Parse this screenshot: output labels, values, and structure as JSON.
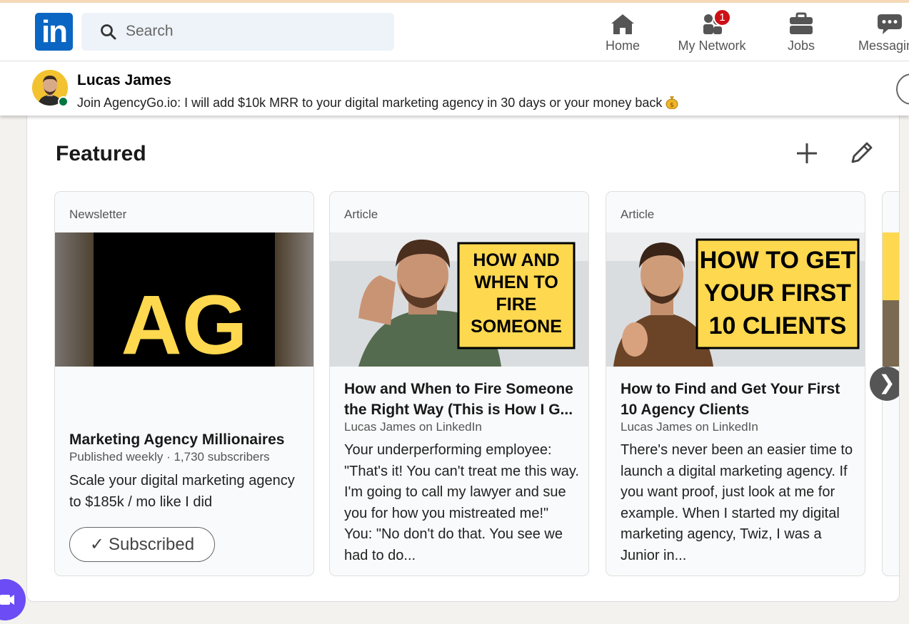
{
  "nav": {
    "logo_text": "in",
    "search_placeholder": "Search",
    "items": [
      {
        "label": "Home",
        "icon": "home-icon"
      },
      {
        "label": "My Network",
        "icon": "people-icon",
        "badge": "1"
      },
      {
        "label": "Jobs",
        "icon": "briefcase-icon"
      },
      {
        "label": "Messaging",
        "icon": "messaging-icon"
      }
    ]
  },
  "profile": {
    "name": "Lucas James",
    "headline": "Join AgencyGo.io: I will add $10k MRR to your digital marketing agency in 30 days or your money back"
  },
  "featured": {
    "title": "Featured",
    "items": [
      {
        "type": "Newsletter",
        "logo_text": "AG",
        "title": "Marketing Agency Millionaires",
        "subtitle": "Published weekly · 1,730 subscribers",
        "description": "Scale your digital marketing agency to $185k / mo like I did",
        "button_label": "Subscribed"
      },
      {
        "type": "Article",
        "thumb_text": [
          "HOW AND",
          "WHEN TO",
          "FIRE",
          "SOMEONE"
        ],
        "title": "How and When to Fire Someone the Right Way (This is How I G...",
        "author": "Lucas James on LinkedIn",
        "description": "Your underperforming employee: \"That's it! You can't treat me this way. I'm going to call my lawyer and sue you for how you mistreated me!\" You: \"No don't do that. You see we had to do..."
      },
      {
        "type": "Article",
        "thumb_text": [
          "HOW TO GET",
          "YOUR FIRST",
          "10 CLIENTS"
        ],
        "title": "How to Find and Get Your First 10 Agency Clients",
        "author": "Lucas James on LinkedIn",
        "description": "There's never been an easier time to launch a digital marketing agency. If you want proof, just look at me for example. When I started my digital marketing agency, Twiz, I was a Junior in..."
      }
    ],
    "next_label": "❯"
  },
  "colors": {
    "brand": "#0a66c2",
    "badge": "#cc1016",
    "thumb_yellow": "#fed84f"
  }
}
